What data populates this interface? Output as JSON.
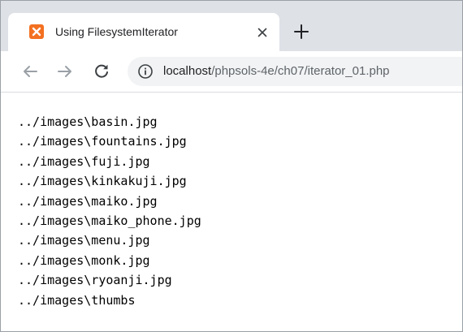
{
  "tab": {
    "title": "Using FilesystemIterator",
    "favicon": "xampp-icon",
    "close_icon": "close-icon"
  },
  "toolbar": {
    "new_tab_icon": "plus-icon",
    "back_icon": "back-arrow-icon",
    "forward_icon": "forward-arrow-icon",
    "reload_icon": "reload-icon",
    "site_info_icon": "info-icon"
  },
  "address_bar": {
    "host": "localhost",
    "path": "/phpsols-4e/ch07/iterator_01.php"
  },
  "page": {
    "lines": [
      "../images\\basin.jpg",
      "../images\\fountains.jpg",
      "../images\\fuji.jpg",
      "../images\\kinkakuji.jpg",
      "../images\\maiko.jpg",
      "../images\\maiko_phone.jpg",
      "../images\\menu.jpg",
      "../images\\monk.jpg",
      "../images\\ryoanji.jpg",
      "../images\\thumbs"
    ]
  },
  "colors": {
    "tabbar_bg": "#dee1e6",
    "omnibox_bg": "#f1f3f4",
    "favicon": "#f37021"
  }
}
